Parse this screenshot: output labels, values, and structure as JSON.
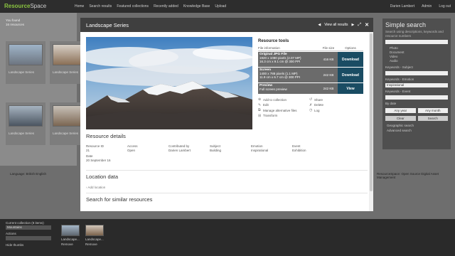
{
  "app": {
    "logo_prefix": "Resource",
    "logo_suffix": "Space",
    "nav": [
      "Home",
      "Search results",
      "Featured collections",
      "Recently added",
      "Knowledge Base",
      "Upload"
    ],
    "user": [
      "Darien Lambert",
      "Admin",
      "Log out"
    ]
  },
  "background": {
    "results_label": "You found",
    "results_count": "16 resources",
    "display_label": "Display",
    "sort_label": "Sort order",
    "sort_value": "As added",
    "card_label_1": "Landscape Series",
    "card_label_2": "Landscape Series",
    "card_label_3": "Landscape Series",
    "card_label_4": "Landscape Series",
    "language": "Language: British English",
    "footer_right": "ResourceSpace: Open Source Digital Asset Management"
  },
  "simple_search": {
    "title": "Simple search",
    "subtitle": "Search using descriptions, keywords and resource numbers",
    "types": [
      "Photo",
      "Document",
      "Video",
      "Audio"
    ],
    "subject_label": "Keywords - Subject",
    "emotion_label": "Keywords - Emotion",
    "emotion_value": "Inspirational",
    "event_label": "Keywords - Event",
    "date_label": "By date",
    "year_value": "Any year",
    "month_value": "Any month",
    "clear_label": "Clear",
    "search_label": "Search",
    "geo_link": "Geographic search",
    "advanced_link": "Advanced search"
  },
  "collection_bar": {
    "current_label": "Current collection (8 items)",
    "current_value": "Mountains",
    "actions_label": "Actions",
    "hide_thumbs": "Hide thumbs",
    "items": [
      {
        "caption": "Landscape...",
        "remove": "Remove"
      },
      {
        "caption": "Landscape...",
        "remove": "Remove"
      }
    ]
  },
  "modal": {
    "title": "Landscape Series",
    "view_all": "View all results",
    "resource_tools": {
      "title": "Resource tools",
      "col_info": "File information",
      "col_size": "File size",
      "col_options": "Options",
      "rows": [
        {
          "name": "Original JPG File",
          "line1": "1920 x 1080 pixels (2.07 MP)",
          "line2": "16.3 cm x 9.1 cm @ 300 PPI",
          "size": "416 KB",
          "action": "Download"
        },
        {
          "name": "Screen",
          "line1": "1400 x 788 pixels (1.1 MP)",
          "line2": "11.9 cm x 6.7 cm @ 300 PPI",
          "size": "242 KB",
          "action": "Download"
        },
        {
          "name": "Preview",
          "line1": "Full screen preview",
          "line2": "",
          "size": "242 KB",
          "action": "View"
        }
      ],
      "actions_left": [
        "Add to collection",
        "Edit",
        "Manage alternative files",
        "Transform"
      ],
      "actions_right": [
        "Share",
        "Delete",
        "Log"
      ]
    },
    "details_title": "Resource details",
    "fields": [
      {
        "label": "Resource ID",
        "value": "21"
      },
      {
        "label": "Access",
        "value": "Open"
      },
      {
        "label": "Contributed by",
        "value": "Darien Lambert"
      },
      {
        "label": "Subject",
        "value": "Building"
      },
      {
        "label": "Emotion",
        "value": "Inspirational"
      },
      {
        "label": "Event",
        "value": "Exhibition"
      },
      {
        "label": "Date",
        "value": "20 September 16"
      }
    ],
    "location_title": "Location data",
    "add_location": "Add location",
    "similar_title": "Search for similar resources"
  }
}
